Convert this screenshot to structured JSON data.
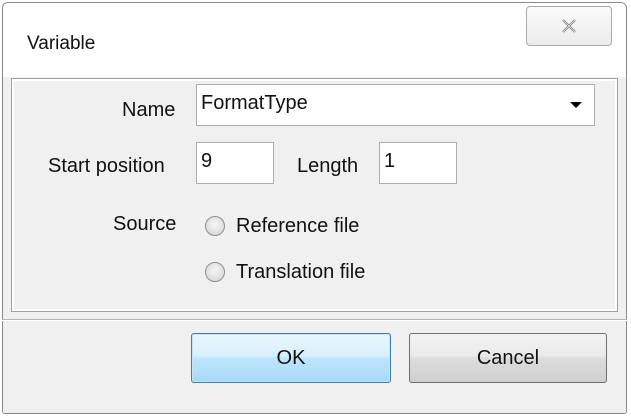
{
  "window": {
    "title": "Variable"
  },
  "form": {
    "name_label": "Name",
    "name_value": "FormatType",
    "start_position_label": "Start position",
    "start_position_value": "9",
    "length_label": "Length",
    "length_value": "1",
    "source_label": "Source",
    "source_options": [
      {
        "label": "Reference file",
        "selected": false
      },
      {
        "label": "Translation file",
        "selected": false
      }
    ]
  },
  "buttons": {
    "ok_label": "OK",
    "cancel_label": "Cancel"
  }
}
